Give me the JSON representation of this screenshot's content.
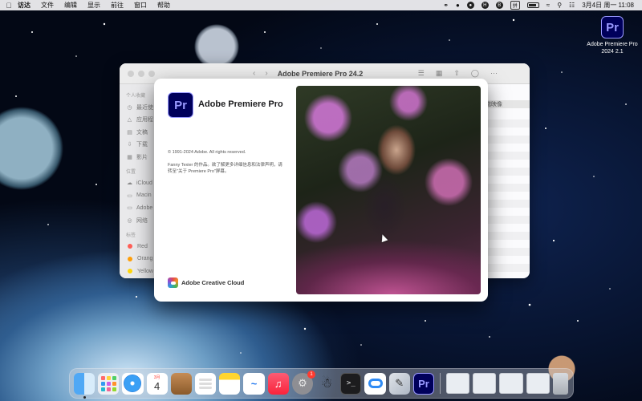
{
  "menubar": {
    "app_name": "访达",
    "menus": [
      "文件",
      "编辑",
      "显示",
      "前往",
      "窗口",
      "帮助"
    ],
    "status_icons": [
      "link-icon",
      "bell-icon",
      "record-icon",
      "h-icon",
      "b-icon",
      "input-method-icon",
      "battery-icon",
      "wifi-icon",
      "search-icon",
      "control-center-icon"
    ],
    "input_method": "拼",
    "clock": "3月4日 周一  11:08"
  },
  "desktop_icon": {
    "icon_text": "Pr",
    "label": "Adobe Premiere Pro 2024 2.1"
  },
  "finder": {
    "title": "Adobe Premiere Pro 24.2",
    "sidebar": {
      "favorites_header": "个人收藏",
      "favorites": [
        {
          "label": "最近使",
          "icon": "clock-icon"
        },
        {
          "label": "应用程",
          "icon": "apps-icon"
        },
        {
          "label": "文稿",
          "icon": "document-icon"
        },
        {
          "label": "下载",
          "icon": "download-icon"
        },
        {
          "label": "影片",
          "icon": "film-icon"
        }
      ],
      "locations_header": "位置",
      "locations": [
        {
          "label": "iCloud",
          "icon": "cloud-icon"
        },
        {
          "label": "Macin",
          "icon": "disk-icon"
        },
        {
          "label": "Adobe",
          "icon": "disk-icon"
        },
        {
          "label": "网络",
          "icon": "globe-icon"
        }
      ],
      "tags_header": "标签",
      "tags": [
        {
          "label": "Red",
          "color": "#ff5f57"
        },
        {
          "label": "Orang",
          "color": "#ff9f0a"
        },
        {
          "label": "Yellow",
          "color": "#ffd60a"
        }
      ]
    },
    "column_header": "磁映像"
  },
  "splash": {
    "logo_text": "Pr",
    "product_name": "Adobe Premiere Pro",
    "copyright": "© 1991-2024 Adobe. All rights reserved.",
    "credit": "Fanny Texier 的作品。欲了解更多详细信息和法律声明，请转至\"关于 Premiere Pro\"屏幕。",
    "footer": "Adobe Creative Cloud"
  },
  "dock": {
    "calendar_month": "3月",
    "calendar_day": "4",
    "settings_badge": "1",
    "premiere_text": "Pr",
    "terminal_text": ">_"
  },
  "colors": {
    "premiere_bg": "#00005b",
    "premiere_accent": "#9999ff"
  }
}
